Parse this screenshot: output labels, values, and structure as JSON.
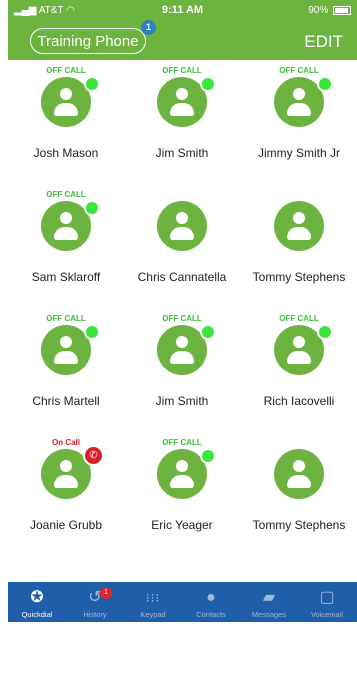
{
  "status_bar": {
    "carrier": "AT&T",
    "time": "9:11 AM",
    "battery": "90%"
  },
  "header": {
    "phone_name": "Training Phone",
    "phone_badge": "1",
    "edit_label": "EDIT"
  },
  "contacts": [
    {
      "name": "Josh Mason",
      "status": "OFF CALL"
    },
    {
      "name": "Jim Smith",
      "status": "OFF CALL"
    },
    {
      "name": "Jimmy Smith Jr",
      "status": "OFF CALL"
    },
    {
      "name": "Sam Sklaroff",
      "status": "OFF CALL"
    },
    {
      "name": "Chris Cannatella",
      "status": ""
    },
    {
      "name": "Tommy Stephens",
      "status": ""
    },
    {
      "name": "Chris Martell",
      "status": "OFF CALL"
    },
    {
      "name": "Jim Smith",
      "status": "OFF CALL"
    },
    {
      "name": "Rich Iacovelli",
      "status": "OFF CALL"
    },
    {
      "name": "Joanie Grubb",
      "status": "On Call"
    },
    {
      "name": "Eric Yeager",
      "status": "OFF CALL"
    },
    {
      "name": "Tommy Stephens",
      "status": ""
    }
  ],
  "tabs": [
    {
      "label": "Quickdial",
      "icon": "star-icon"
    },
    {
      "label": "History",
      "icon": "history-icon",
      "badge": "1"
    },
    {
      "label": "Keypad",
      "icon": "keypad-icon"
    },
    {
      "label": "Contacts",
      "icon": "person-icon"
    },
    {
      "label": "Messages",
      "icon": "chat-icon"
    },
    {
      "label": "Voicemail",
      "icon": "voicemail-icon"
    }
  ],
  "colors": {
    "brand_green": "#6db33f",
    "tab_blue": "#1f5ea8",
    "arrow_red": "#e8312f"
  }
}
